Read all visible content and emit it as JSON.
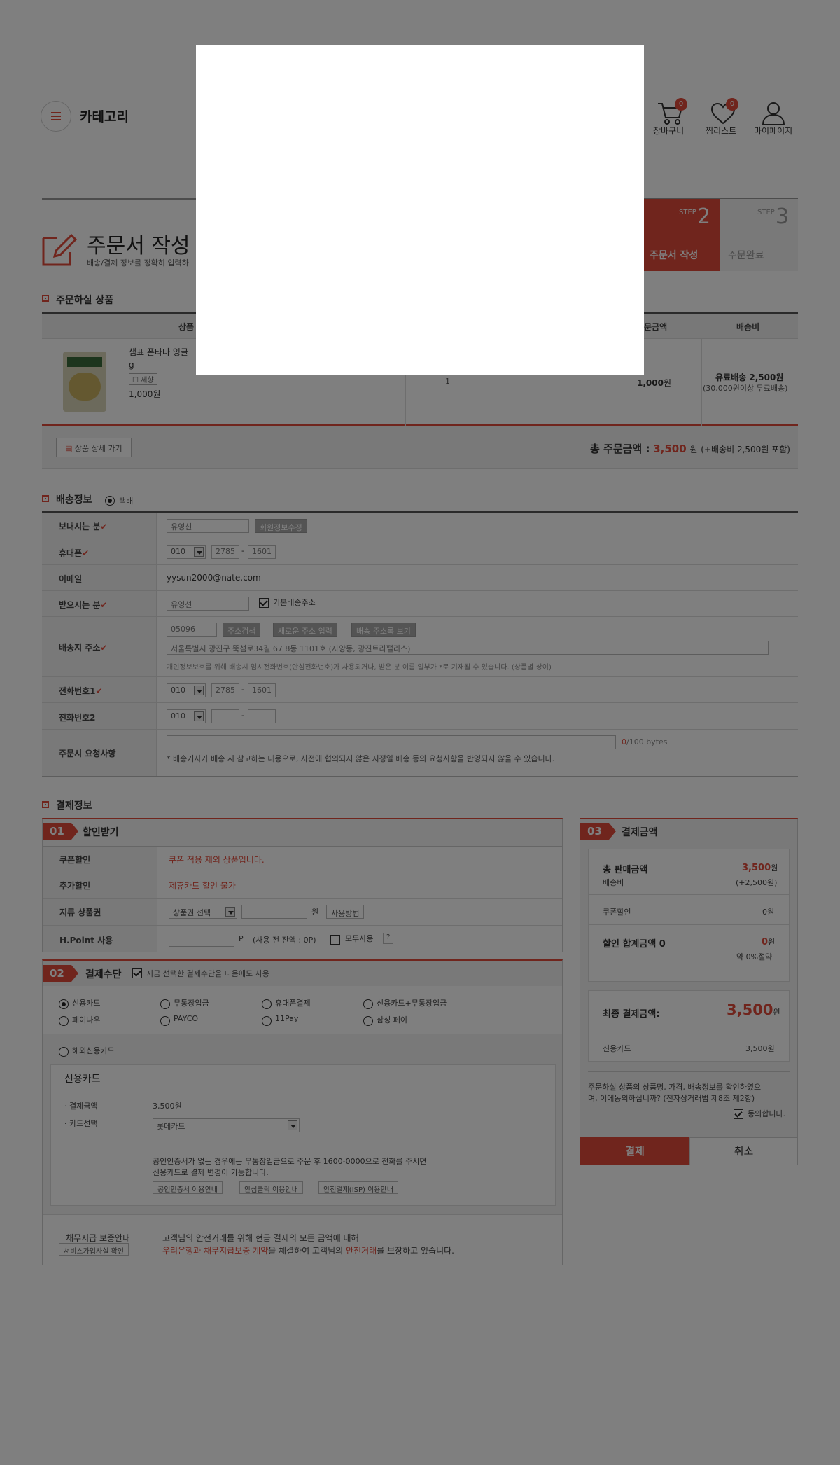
{
  "header": {
    "category_label": "카테고리",
    "cart_label": "장바구니",
    "cart_count": "0",
    "wishlist_label": "찜리스트",
    "wishlist_count": "0",
    "mypage_label": "마이페이지"
  },
  "page": {
    "title": "주문서 작성",
    "subtitle": "배송/결제 정보를 정확히 입력하"
  },
  "steps": {
    "step2_prefix": "STEP",
    "step2_num": "2",
    "step2_label": "주문서 작성",
    "step3_prefix": "STEP",
    "step3_num": "3",
    "step3_label": "주문완료"
  },
  "order": {
    "section_title": "주문하실 상품",
    "col_product": "상품",
    "col_amount": "문금액",
    "col_shipping": "배송비",
    "item": {
      "name": "샘표 폰타나 잉글",
      "weight": "g",
      "option": "세향",
      "price": "1,000원",
      "qty": "1",
      "amount": "1,000",
      "amount_unit": "원",
      "shipping_main": "유료배송 2,500원",
      "shipping_note": "(30,000원이상 무료배송)"
    },
    "detail_button": "상품 상세 가기",
    "total_label": "총 주문금액 :",
    "total_value": "3,500",
    "total_unit": "원",
    "total_note": "(+배송비 2,500원 포함)"
  },
  "delivery": {
    "section_title": "배송정보",
    "method": "택배",
    "sender_label": "보내시는 분",
    "sender_value": "유영선",
    "sender_btn": "회원정보수정",
    "phone_label": "휴대폰",
    "phone1": "010",
    "phone2": "2785",
    "phone3": "1601",
    "email_label": "이메일",
    "email_value": "yysun2000@nate.com",
    "receiver_label": "받으시는 분",
    "receiver_value": "유영선",
    "default_addr_label": "기본배송주소",
    "address_label": "배송지 주소",
    "zipcode": "05096",
    "addr_btn1": "주소검색",
    "addr_btn2": "새로운 주소 입력",
    "addr_btn3": "배송 주소록 보기",
    "addr_value": "서울특별시 광진구 뚝섬로34길 67 8동 1101호 (자양동, 광진트라팰리스)",
    "addr_notice": "개인정보보호를 위해 배송시 임시전화번호(안심전화번호)가 사용되거나, 받은 분 이름 일부가 *로 기재될 수 있습니다. (상품별 상이)",
    "tel1_label": "전화번호1",
    "tel1_a": "010",
    "tel1_b": "2785",
    "tel1_c": "1601",
    "tel2_label": "전화번호2",
    "tel2_a": "010",
    "request_label": "주문시 요청사항",
    "request_count": "0",
    "request_max": "/100 bytes",
    "request_notice": "* 배송기사가 배송 시 참고하는 내용으로, 사전에 협의되지 않은 지정일 배송 등의 요청사항을 반영되지 않을 수 있습니다."
  },
  "payment": {
    "section_title": "결제정보",
    "discount": {
      "num": "01",
      "title": "할인받기",
      "coupon_label": "쿠폰할인",
      "coupon_value": "쿠폰 적용 제외 상품입니다.",
      "extra_label": "추가할인",
      "extra_value": "제휴카드 할인 불가",
      "gift_label": "지류 상품권",
      "gift_select": "상품권 선택",
      "gift_unit": "원",
      "gift_btn": "사용방법",
      "hpoint_label": "H.Point 사용",
      "hpoint_unit": "P",
      "hpoint_note": "(사용 전 잔액 : 0P)",
      "hpoint_all": "모두사용",
      "hpoint_help": "?"
    },
    "method": {
      "num": "02",
      "title": "결제수단",
      "remember_label": "지금 선택한 결제수단을 다음에도 사용",
      "options": [
        "신용카드",
        "무통장입금",
        "휴대폰결제",
        "신용카드+무통장입금",
        "페이나우",
        "PAYCO",
        "11Pay",
        "삼성 페이",
        "해외신용카드"
      ],
      "card_title": "신용카드",
      "card_amount_label": "· 결제금액",
      "card_amount_value": "3,500원",
      "card_select_label": "· 카드선택",
      "card_select_value": "롯데카드",
      "cert_note1": "공인인증서가 없는 경우에는 무통장입금으로 주문 후 1600-0000으로 전화를 주시면",
      "cert_note2": "신용카드로 결제 변경이 가능합니다.",
      "guide_btn1": "공인인증서 이용안내",
      "guide_btn2": "안심클릭 이용안내",
      "guide_btn3": "안전결제(ISP) 이용안내"
    },
    "guarantee": {
      "title": "채무지급 보증안내",
      "btn": "서비스가입사실 확인",
      "line1": "고객님의 안전거래를 위해 현금 결제의 모든 금액에 대해",
      "line2_red1": "우리은행과 채무지급보증 계약",
      "line2_mid": "을 체결하여 고객님의",
      "line2_red2": "안전거래",
      "line2_end": "를 보장하고 있습니다."
    },
    "summary": {
      "num": "03",
      "title": "결제금액",
      "total_sales_label": "총 판매금액",
      "total_sales_value": "3,500",
      "won": "원",
      "shipping_label": "배송비",
      "shipping_value": "(+2,500원)",
      "coupon_label": "쿠폰할인",
      "coupon_value": "0원",
      "discount_total_label": "할인 합계금액 0",
      "discount_total_value": "0",
      "discount_rate": "약 0%절약",
      "final_label": "최종 결제금액:",
      "final_value": "3,500",
      "final_unit": "원",
      "card_label": "신용카드",
      "card_value": "3,500원",
      "consent_text1": "주문하실 상품의 상품명, 가격, 배송정보를 확인하였으",
      "consent_text2": "며, 이에동의하십니까? (전자상거래법 제8조 제2항)",
      "agree_label": "동의합니다.",
      "pay_btn": "결제",
      "cancel_btn": "취소"
    }
  },
  "colors": {
    "accent": "#e04a3a",
    "overlay": "rgba(0,0,0,0.5)"
  }
}
